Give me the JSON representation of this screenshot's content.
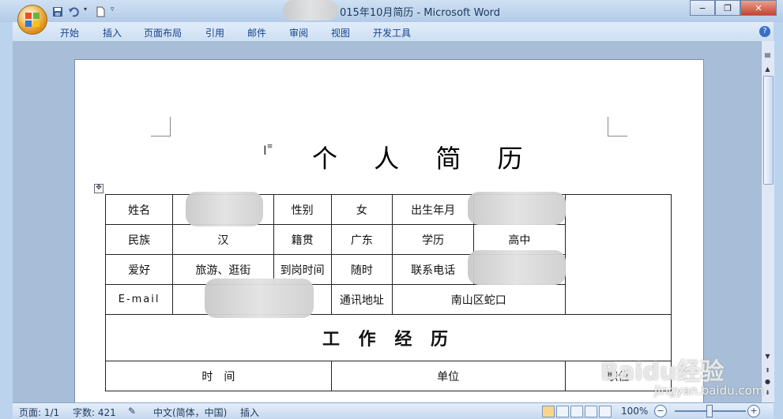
{
  "window": {
    "title": "015年10月简历 - Microsoft Word",
    "min_label": "−",
    "restore_label": "❐",
    "close_label": "✕"
  },
  "ribbon": {
    "tabs": [
      "开始",
      "插入",
      "页面布局",
      "引用",
      "邮件",
      "审阅",
      "视图",
      "开发工具"
    ],
    "help_label": "?"
  },
  "document": {
    "title": "个 人 简 历",
    "table": {
      "row1": {
        "c1": "姓名",
        "c3": "性别",
        "c4": "女",
        "c5": "出生年月"
      },
      "row2": {
        "c1": "民族",
        "c2": "汉",
        "c3": "籍贯",
        "c4": "广东",
        "c5": "学历",
        "c6": "高中"
      },
      "row3": {
        "c1": "爱好",
        "c2": "旅游、逛街",
        "c3": "到岗时间",
        "c4": "随时",
        "c5": "联系电话"
      },
      "row4": {
        "c1": "E-mail",
        "c3": "通讯地址",
        "c4": "南山区蛇口"
      },
      "section_header": "工 作 经 历",
      "work_headers": [
        "时　间",
        "单位",
        "职位"
      ]
    }
  },
  "statusbar": {
    "page": "页面: 1/1",
    "words": "字数: 421",
    "language": "中文(简体，中国)",
    "mode": "插入",
    "zoom": "100%",
    "zoom_out": "−",
    "zoom_in": "+"
  },
  "watermark": {
    "brand": "Baidu经验",
    "url": "jingyan.baidu.com"
  },
  "icons": [
    "office-logo-icon",
    "save-icon",
    "undo-icon",
    "new-doc-icon",
    "qat-dropdown-icon",
    "help-icon",
    "table-move-icon",
    "text-cursor-icon",
    "spellcheck-icon",
    "view-print-icon",
    "view-fullscreen-icon",
    "view-web-icon",
    "view-outline-icon",
    "view-draft-icon"
  ]
}
